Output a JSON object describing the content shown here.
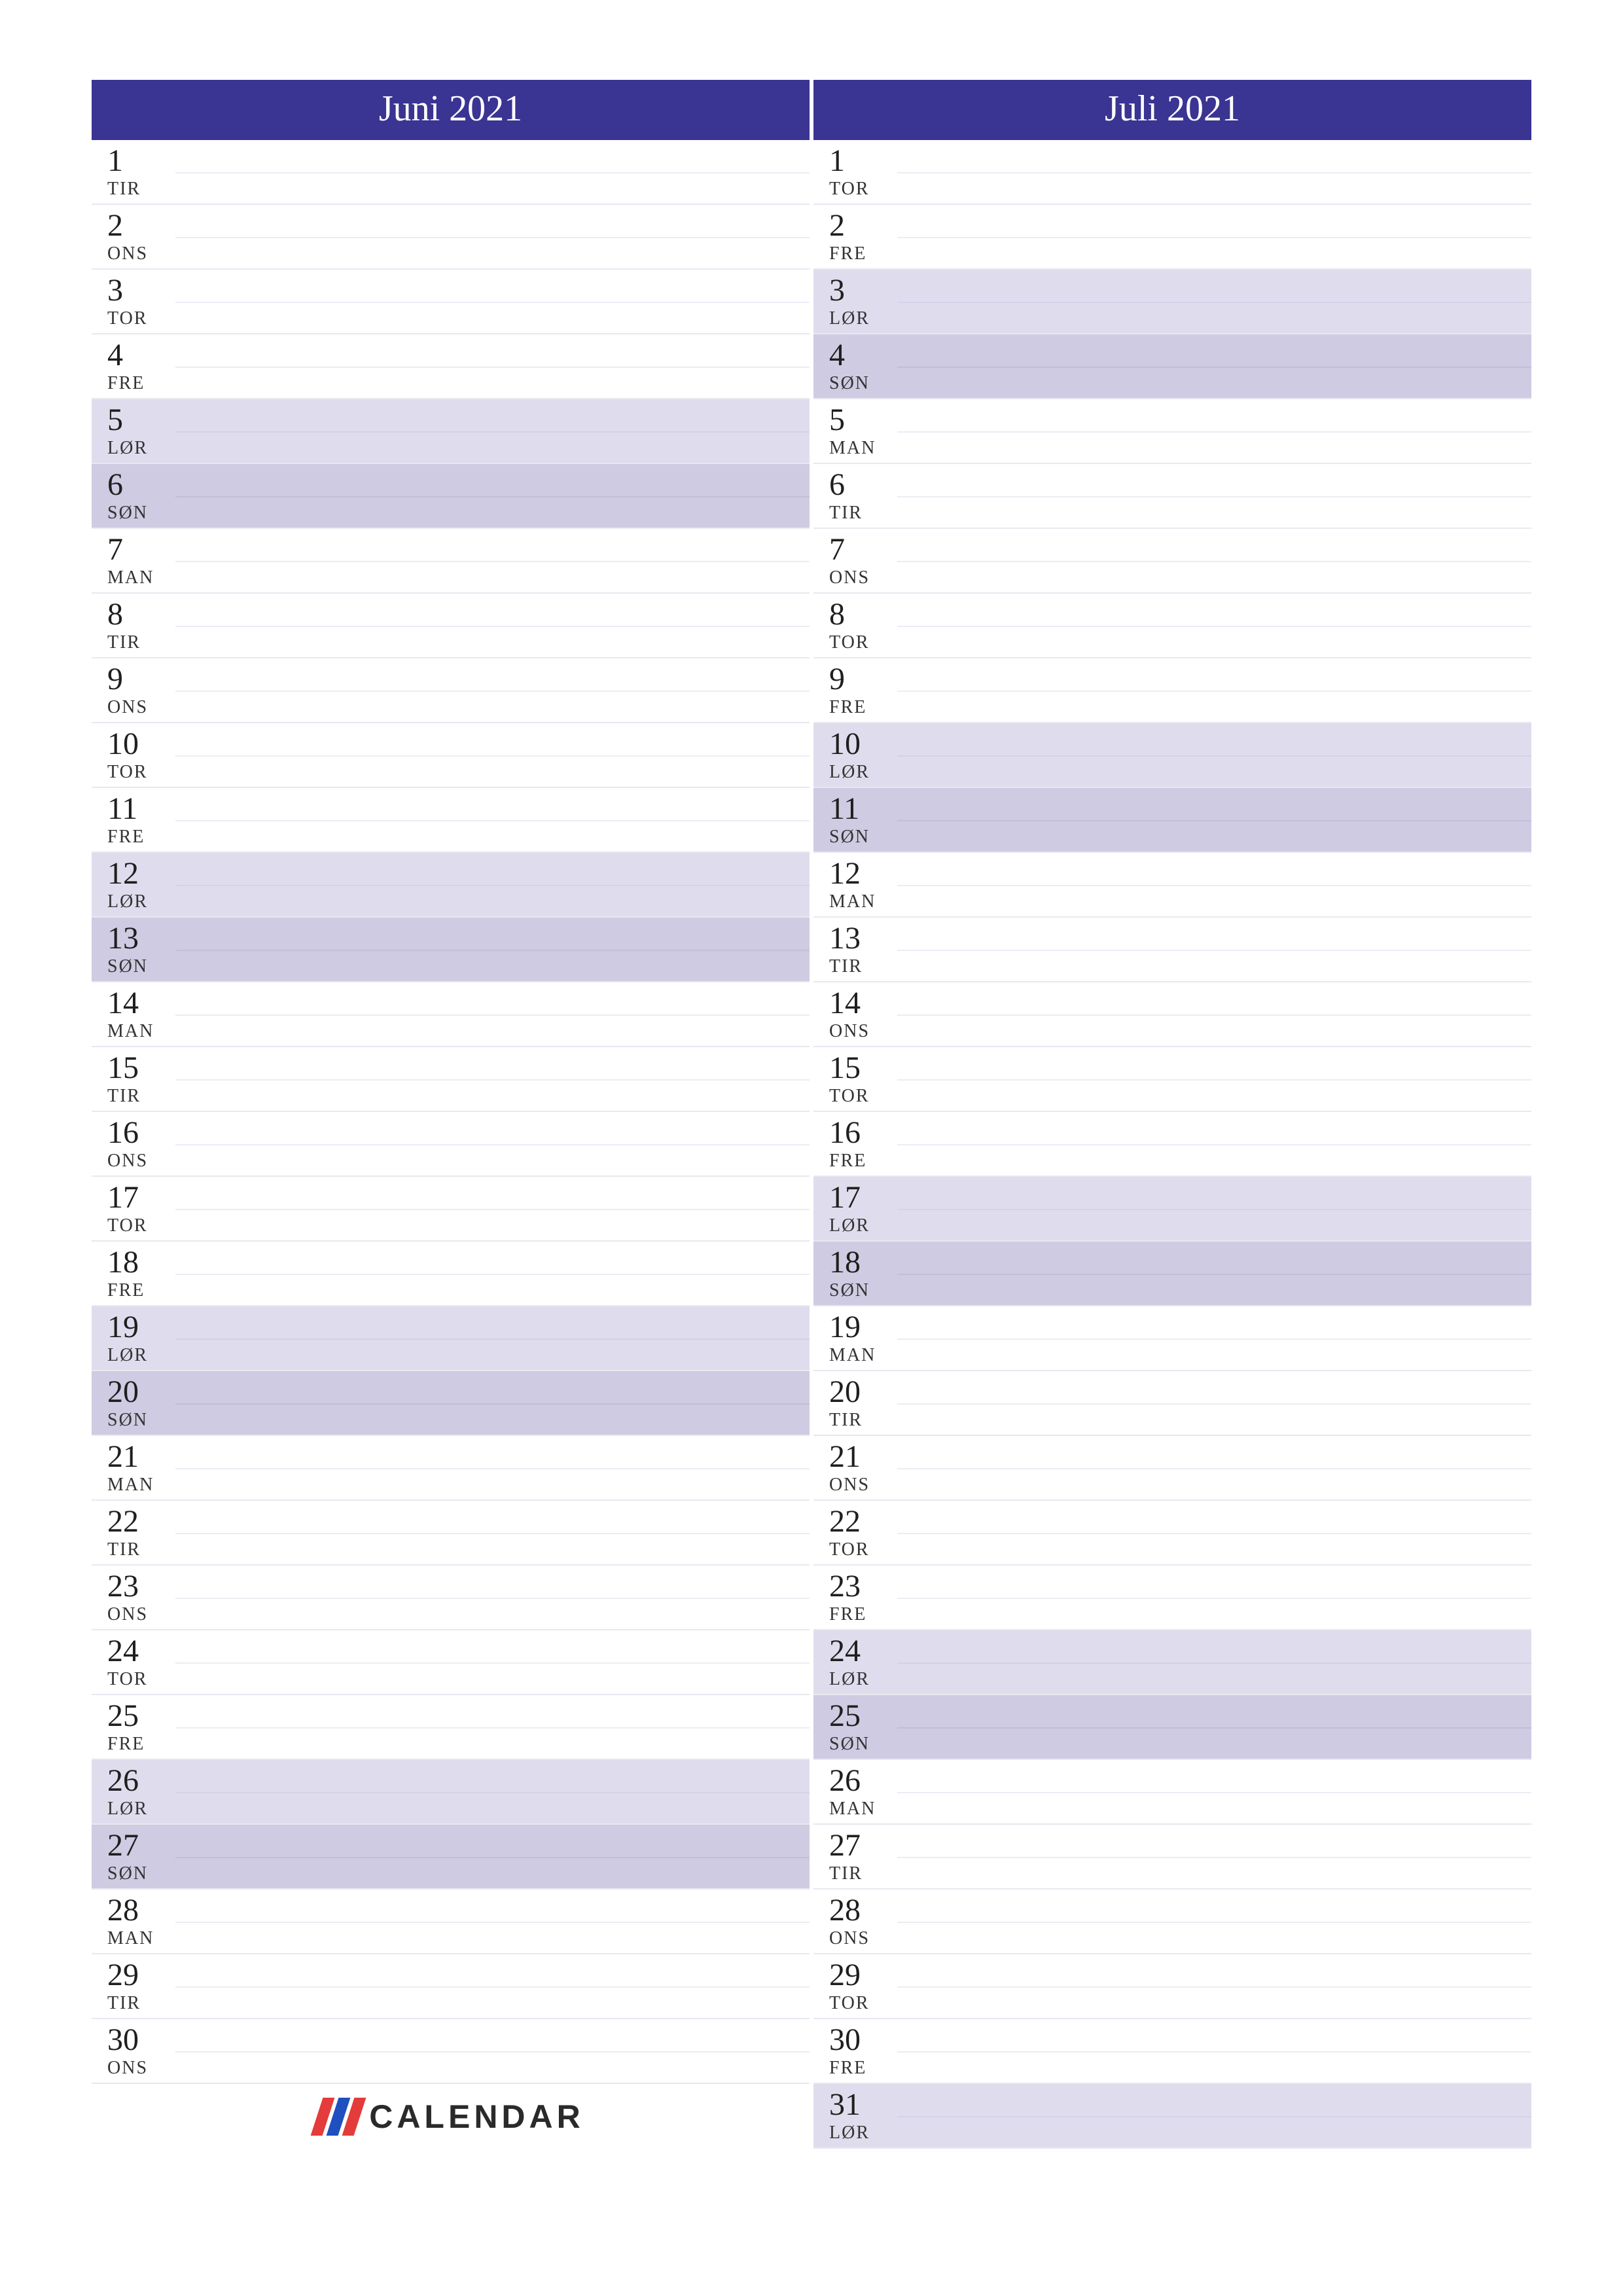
{
  "logo_text": "CALENDAR",
  "months": [
    {
      "title": "Juni 2021",
      "days": [
        {
          "num": "1",
          "name": "TIR",
          "type": "weekday"
        },
        {
          "num": "2",
          "name": "ONS",
          "type": "weekday"
        },
        {
          "num": "3",
          "name": "TOR",
          "type": "weekday"
        },
        {
          "num": "4",
          "name": "FRE",
          "type": "weekday"
        },
        {
          "num": "5",
          "name": "LØR",
          "type": "saturday"
        },
        {
          "num": "6",
          "name": "SØN",
          "type": "sunday"
        },
        {
          "num": "7",
          "name": "MAN",
          "type": "weekday"
        },
        {
          "num": "8",
          "name": "TIR",
          "type": "weekday"
        },
        {
          "num": "9",
          "name": "ONS",
          "type": "weekday"
        },
        {
          "num": "10",
          "name": "TOR",
          "type": "weekday"
        },
        {
          "num": "11",
          "name": "FRE",
          "type": "weekday"
        },
        {
          "num": "12",
          "name": "LØR",
          "type": "saturday"
        },
        {
          "num": "13",
          "name": "SØN",
          "type": "sunday"
        },
        {
          "num": "14",
          "name": "MAN",
          "type": "weekday"
        },
        {
          "num": "15",
          "name": "TIR",
          "type": "weekday"
        },
        {
          "num": "16",
          "name": "ONS",
          "type": "weekday"
        },
        {
          "num": "17",
          "name": "TOR",
          "type": "weekday"
        },
        {
          "num": "18",
          "name": "FRE",
          "type": "weekday"
        },
        {
          "num": "19",
          "name": "LØR",
          "type": "saturday"
        },
        {
          "num": "20",
          "name": "SØN",
          "type": "sunday"
        },
        {
          "num": "21",
          "name": "MAN",
          "type": "weekday"
        },
        {
          "num": "22",
          "name": "TIR",
          "type": "weekday"
        },
        {
          "num": "23",
          "name": "ONS",
          "type": "weekday"
        },
        {
          "num": "24",
          "name": "TOR",
          "type": "weekday"
        },
        {
          "num": "25",
          "name": "FRE",
          "type": "weekday"
        },
        {
          "num": "26",
          "name": "LØR",
          "type": "saturday"
        },
        {
          "num": "27",
          "name": "SØN",
          "type": "sunday"
        },
        {
          "num": "28",
          "name": "MAN",
          "type": "weekday"
        },
        {
          "num": "29",
          "name": "TIR",
          "type": "weekday"
        },
        {
          "num": "30",
          "name": "ONS",
          "type": "weekday"
        }
      ]
    },
    {
      "title": "Juli 2021",
      "days": [
        {
          "num": "1",
          "name": "TOR",
          "type": "weekday"
        },
        {
          "num": "2",
          "name": "FRE",
          "type": "weekday"
        },
        {
          "num": "3",
          "name": "LØR",
          "type": "saturday"
        },
        {
          "num": "4",
          "name": "SØN",
          "type": "sunday"
        },
        {
          "num": "5",
          "name": "MAN",
          "type": "weekday"
        },
        {
          "num": "6",
          "name": "TIR",
          "type": "weekday"
        },
        {
          "num": "7",
          "name": "ONS",
          "type": "weekday"
        },
        {
          "num": "8",
          "name": "TOR",
          "type": "weekday"
        },
        {
          "num": "9",
          "name": "FRE",
          "type": "weekday"
        },
        {
          "num": "10",
          "name": "LØR",
          "type": "saturday"
        },
        {
          "num": "11",
          "name": "SØN",
          "type": "sunday"
        },
        {
          "num": "12",
          "name": "MAN",
          "type": "weekday"
        },
        {
          "num": "13",
          "name": "TIR",
          "type": "weekday"
        },
        {
          "num": "14",
          "name": "ONS",
          "type": "weekday"
        },
        {
          "num": "15",
          "name": "TOR",
          "type": "weekday"
        },
        {
          "num": "16",
          "name": "FRE",
          "type": "weekday"
        },
        {
          "num": "17",
          "name": "LØR",
          "type": "saturday"
        },
        {
          "num": "18",
          "name": "SØN",
          "type": "sunday"
        },
        {
          "num": "19",
          "name": "MAN",
          "type": "weekday"
        },
        {
          "num": "20",
          "name": "TIR",
          "type": "weekday"
        },
        {
          "num": "21",
          "name": "ONS",
          "type": "weekday"
        },
        {
          "num": "22",
          "name": "TOR",
          "type": "weekday"
        },
        {
          "num": "23",
          "name": "FRE",
          "type": "weekday"
        },
        {
          "num": "24",
          "name": "LØR",
          "type": "saturday"
        },
        {
          "num": "25",
          "name": "SØN",
          "type": "sunday"
        },
        {
          "num": "26",
          "name": "MAN",
          "type": "weekday"
        },
        {
          "num": "27",
          "name": "TIR",
          "type": "weekday"
        },
        {
          "num": "28",
          "name": "ONS",
          "type": "weekday"
        },
        {
          "num": "29",
          "name": "TOR",
          "type": "weekday"
        },
        {
          "num": "30",
          "name": "FRE",
          "type": "weekday"
        },
        {
          "num": "31",
          "name": "LØR",
          "type": "saturday"
        }
      ]
    }
  ]
}
